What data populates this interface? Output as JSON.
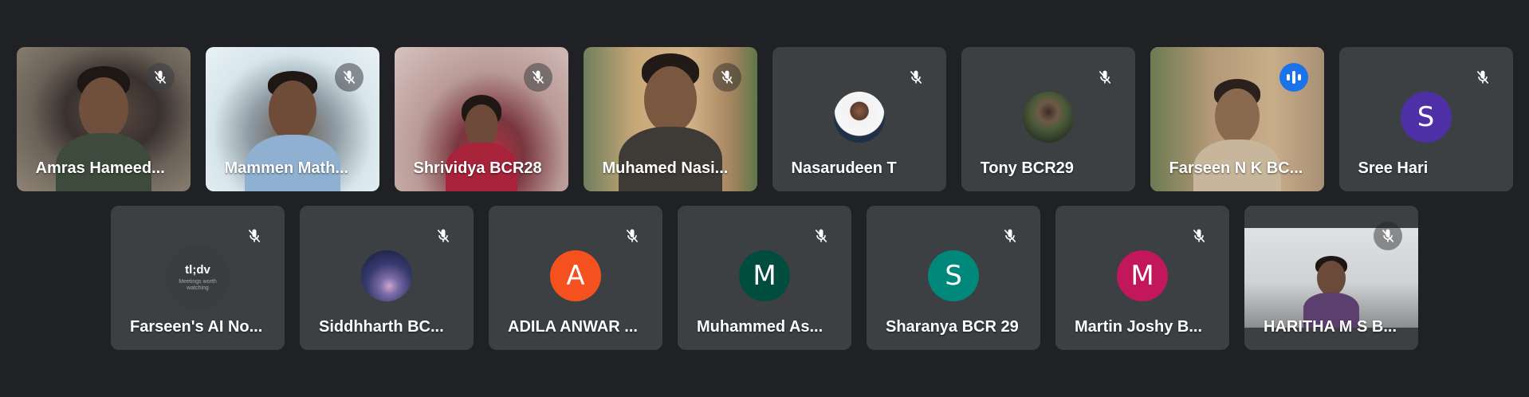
{
  "colors": {
    "background": "#202124",
    "tile": "#3c4043",
    "speaking_outline": "#8ab4f8",
    "speaking_badge": "#1a73e8"
  },
  "participants_row1": [
    {
      "name": "Amras Hameed...",
      "muted": true,
      "tile": "video"
    },
    {
      "name": "Mammen Math...",
      "muted": true,
      "tile": "video"
    },
    {
      "name": "Shrividya BCR28",
      "muted": true,
      "tile": "video"
    },
    {
      "name": "Muhamed Nasi...",
      "muted": true,
      "tile": "video"
    },
    {
      "name": "Nasarudeen T",
      "muted": true,
      "tile": "avatar-photo"
    },
    {
      "name": "Tony BCR29",
      "muted": true,
      "tile": "avatar-photo"
    },
    {
      "name": "Farseen N K BC...",
      "muted": false,
      "speaking": true,
      "tile": "video"
    },
    {
      "name": "Sree Hari",
      "muted": true,
      "tile": "avatar-letter",
      "initial": "S",
      "avatar_color": "#4e2fa8"
    }
  ],
  "participants_row2": [
    {
      "name": "Farseen's AI No...",
      "muted": true,
      "tile": "avatar-logo",
      "logo_text": "tl;dv",
      "logo_subtext": "Meetings worth watching"
    },
    {
      "name": "Siddhharth BC...",
      "muted": true,
      "tile": "avatar-photo"
    },
    {
      "name": "ADILA ANWAR ...",
      "muted": true,
      "tile": "avatar-letter",
      "initial": "A",
      "avatar_color": "#f4511e"
    },
    {
      "name": "Muhammed As...",
      "muted": true,
      "tile": "avatar-letter",
      "initial": "M",
      "avatar_color": "#004d40"
    },
    {
      "name": "Sharanya BCR 29",
      "muted": true,
      "tile": "avatar-letter",
      "initial": "S",
      "avatar_color": "#00897b"
    },
    {
      "name": "Martin Joshy B...",
      "muted": true,
      "tile": "avatar-letter",
      "initial": "M",
      "avatar_color": "#c2185b"
    },
    {
      "name": "HARITHA M S B...",
      "muted": true,
      "tile": "video"
    }
  ],
  "icons": {
    "muted": "mic-off-icon",
    "speaking": "audio-level-icon"
  }
}
